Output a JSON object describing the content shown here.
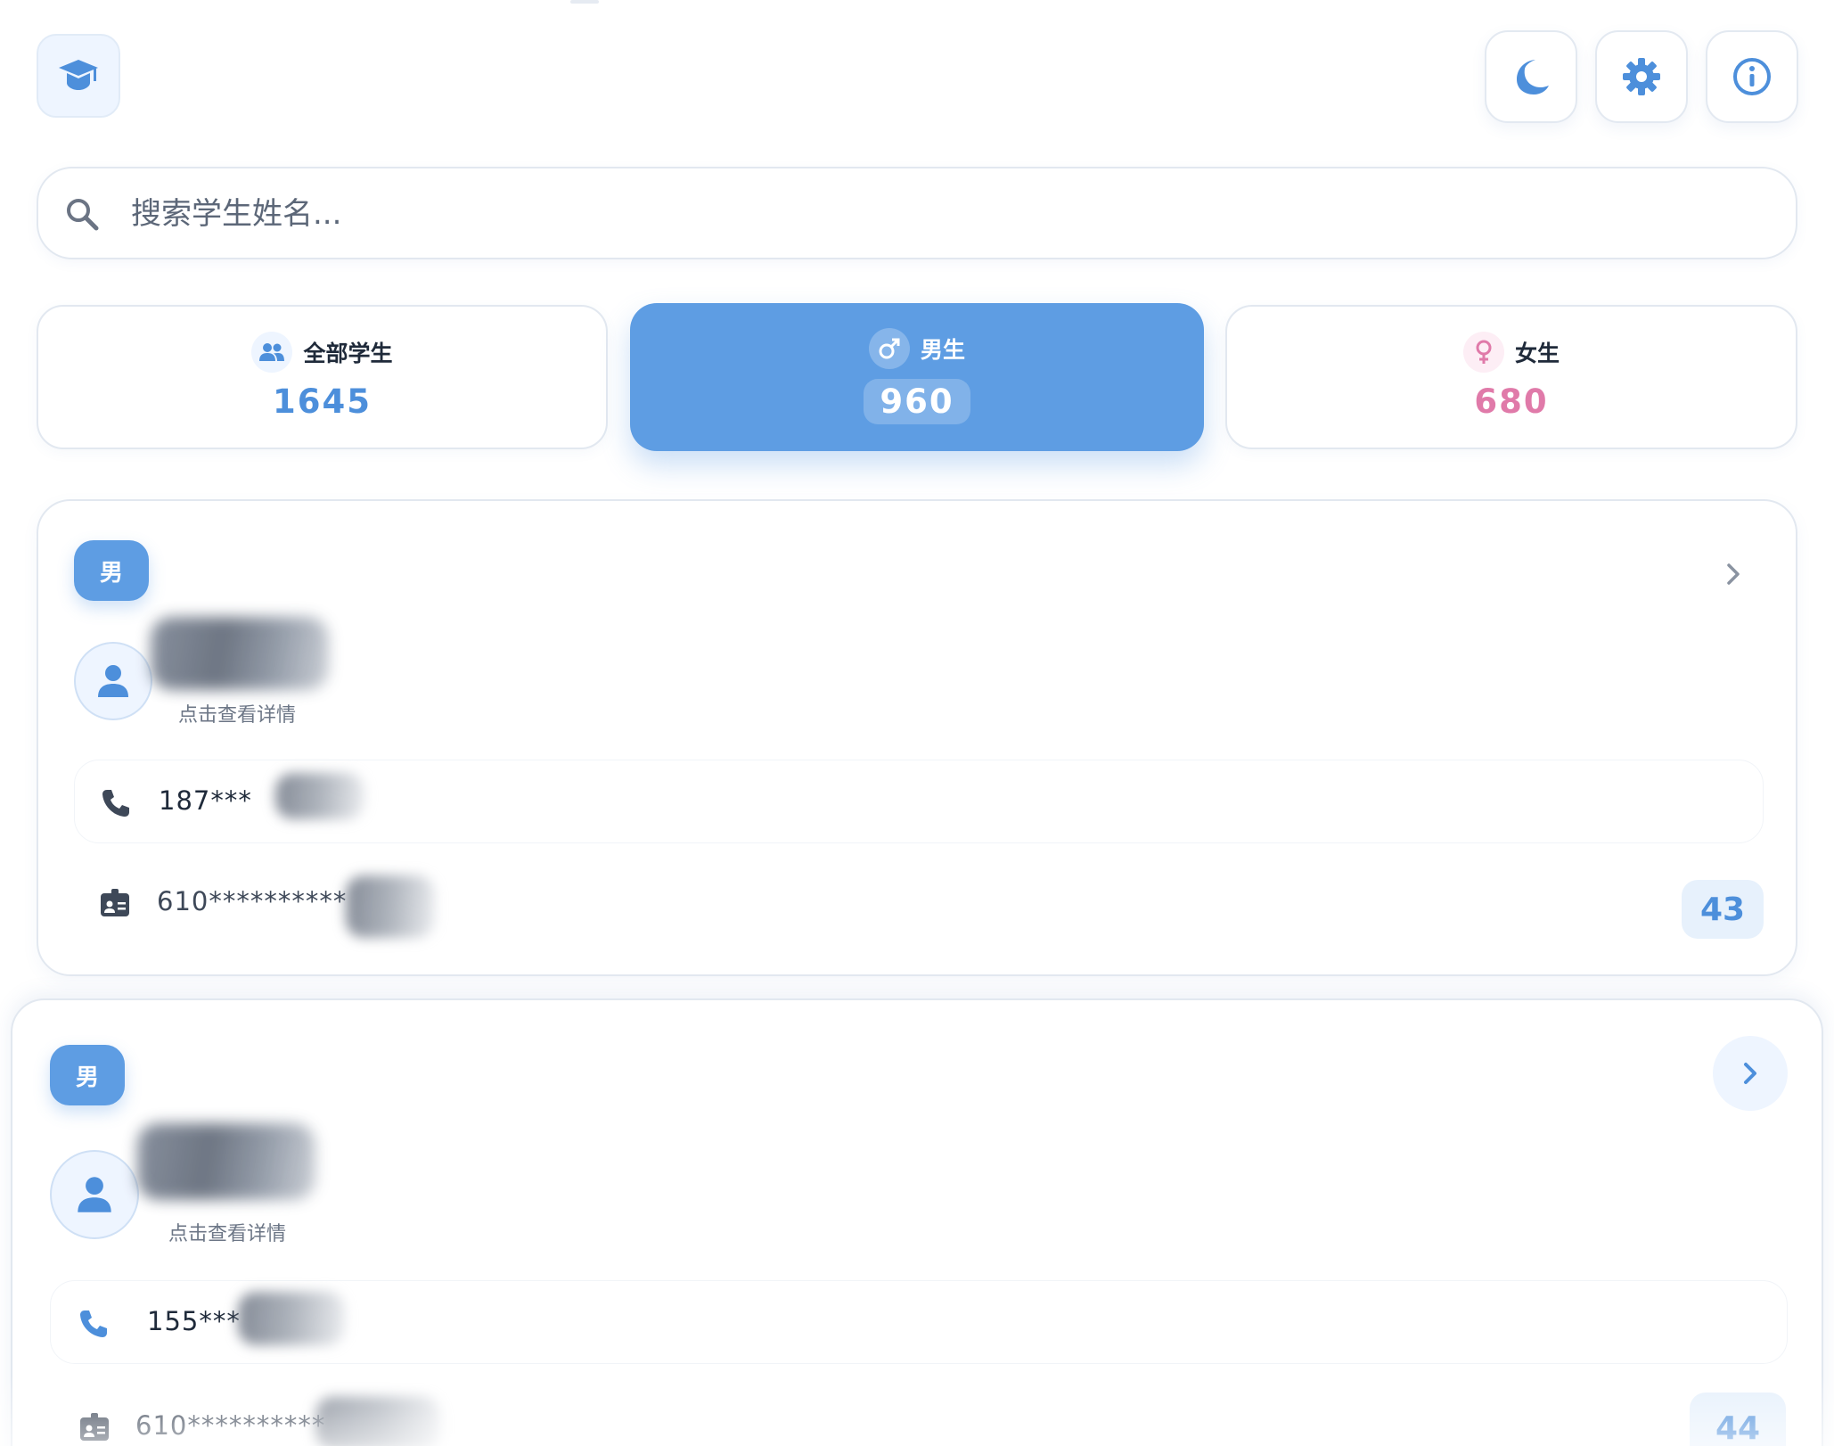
{
  "header": {
    "logo_icon": "graduation-cap-icon",
    "actions": [
      {
        "name": "theme-toggle-button",
        "icon": "moon-icon"
      },
      {
        "name": "settings-button",
        "icon": "gear-icon"
      },
      {
        "name": "info-button",
        "icon": "info-icon"
      }
    ]
  },
  "search": {
    "placeholder": "搜索学生姓名...",
    "value": ""
  },
  "stats": {
    "all": {
      "label": "全部学生",
      "value": "1645",
      "icon": "users-icon"
    },
    "male": {
      "label": "男生",
      "value": "960",
      "icon": "male-symbol-icon",
      "selected": true
    },
    "female": {
      "label": "女生",
      "value": "680",
      "icon": "female-symbol-icon"
    }
  },
  "students": [
    {
      "gender": "男",
      "hint": "点击查看详情",
      "phone": "187***",
      "id_number": "610**********",
      "age": "43"
    },
    {
      "gender": "男",
      "hint": "点击查看详情",
      "phone": "155***",
      "id_number": "610**********",
      "age": "44"
    }
  ],
  "colors": {
    "accent": "#5e9de3",
    "accent_text": "#4d8fdb",
    "female": "#e07aa9",
    "border": "#e2e8f0"
  }
}
